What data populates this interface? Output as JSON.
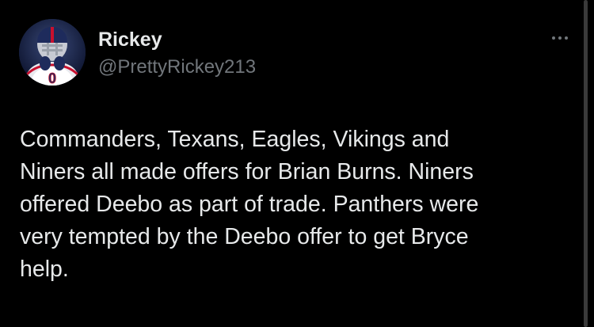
{
  "user": {
    "display_name": "Rickey",
    "handle": "@PrettyRickey213",
    "avatar_icon": "football-player-avatar",
    "jersey_number": "0"
  },
  "tweet": {
    "text": "Commanders, Texans, Eagles, Vikings and\nNiners all made offers for Brian Burns. Niners\noffered Deebo as part of trade. Panthers were\nvery tempted by the Deebo offer to get Bryce\nhelp."
  },
  "menu": {
    "icon": "more-horizontal-icon"
  },
  "colors": {
    "background": "#000000",
    "primary_text": "#e7e9ea",
    "secondary_text": "#71767b"
  }
}
